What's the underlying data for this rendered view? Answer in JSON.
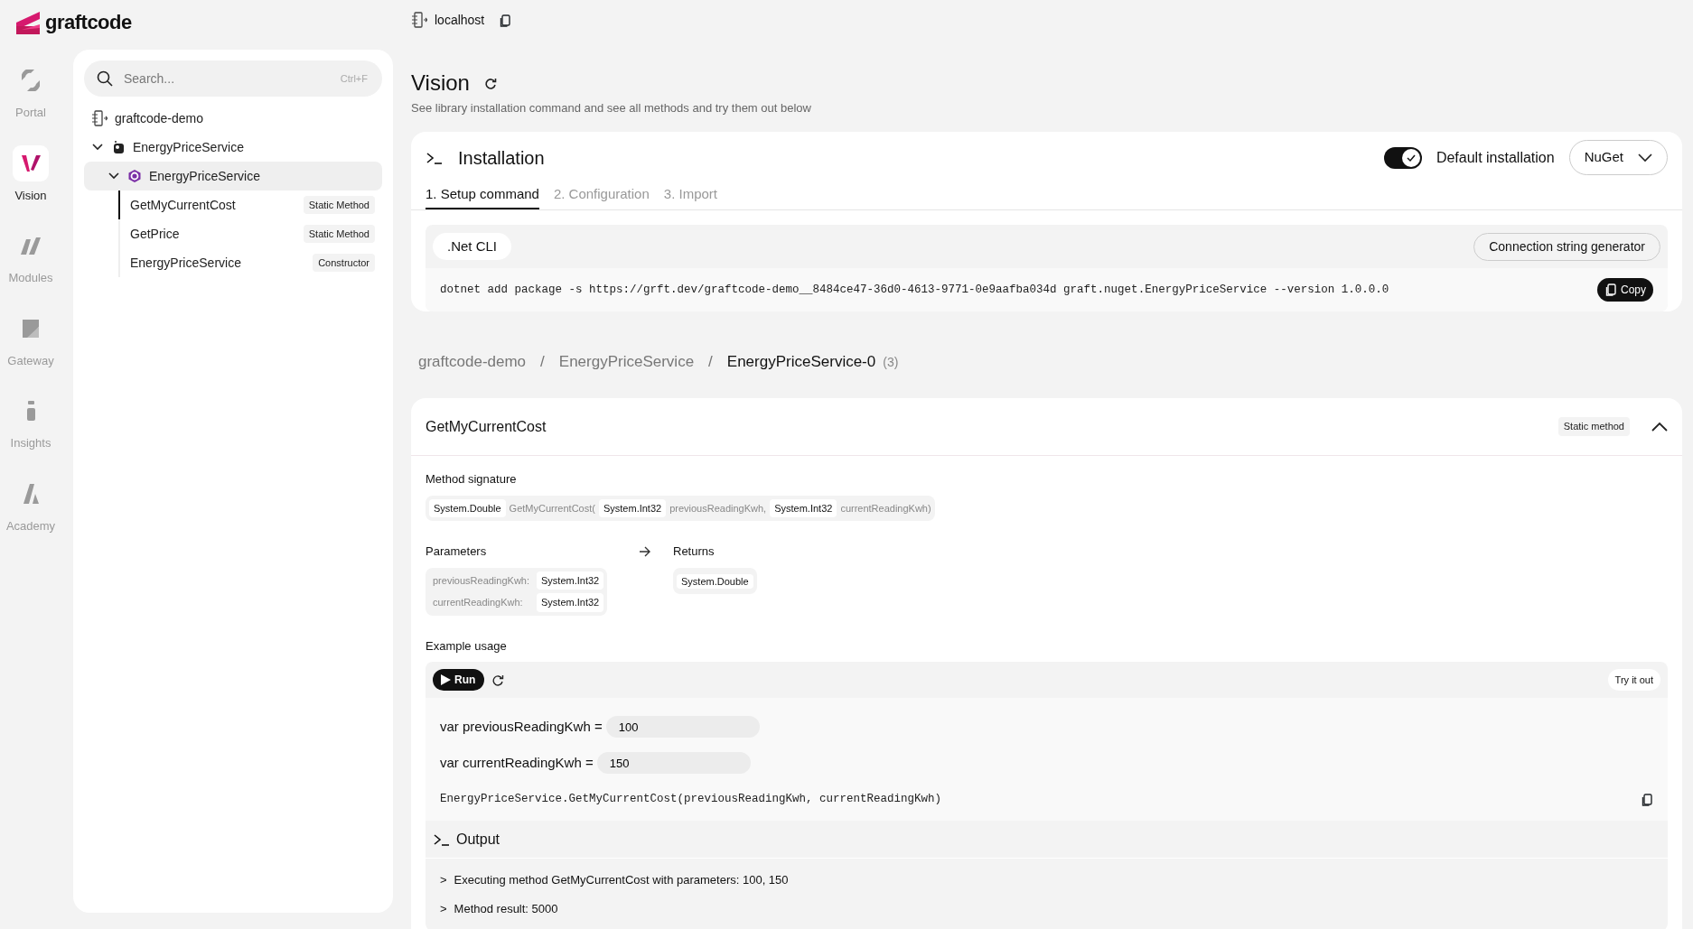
{
  "brand": {
    "name": "graftcode"
  },
  "rail": [
    {
      "label": "Portal",
      "kind": "portal",
      "selected": false
    },
    {
      "label": "Vision",
      "kind": "vision",
      "selected": true
    },
    {
      "label": "Modules",
      "kind": "modules",
      "selected": false
    },
    {
      "label": "Gateway",
      "kind": "gateway",
      "selected": false
    },
    {
      "label": "Insights",
      "kind": "insights",
      "selected": false
    },
    {
      "label": "Academy",
      "kind": "academy",
      "selected": false
    }
  ],
  "search": {
    "placeholder": "Search...",
    "shortcut": "Ctrl+F"
  },
  "tree": [
    {
      "label": "graftcode-demo",
      "kind": "host",
      "children": [
        {
          "label": "EnergyPriceService",
          "kind": "package",
          "expanded": true,
          "selected": false,
          "children": [
            {
              "label": "EnergyPriceService",
              "kind": "class",
              "expanded": true,
              "selected": true,
              "children": [
                {
                  "label": "GetMyCurrentCost",
                  "kind": "method",
                  "badge": "Static Method",
                  "selected": true
                },
                {
                  "label": "GetPrice",
                  "kind": "method",
                  "badge": "Static Method",
                  "selected": false
                },
                {
                  "label": "EnergyPriceService",
                  "kind": "method",
                  "badge": "Constructor",
                  "selected": false
                }
              ]
            }
          ]
        }
      ]
    }
  ],
  "host": {
    "label": "localhost"
  },
  "page": {
    "title": "Vision",
    "subtitle": "See library installation command and see all methods and try them out below"
  },
  "installation": {
    "title": "Installation",
    "default_installation": {
      "label": "Default installation",
      "on": true
    },
    "package_manager": "NuGet",
    "steps": [
      {
        "label": "1. Setup command",
        "selected": true
      },
      {
        "label": "2. Configuration",
        "selected": false
      },
      {
        "label": "3. Import",
        "selected": false
      }
    ],
    "tool_tab": ".Net CLI",
    "generator_button": "Connection string generator",
    "command": "dotnet add package -s https://grft.dev/graftcode-demo__8484ce47-36d0-4613-9771-0e9aafba034d graft.nuget.EnergyPriceService --version 1.0.0.0",
    "copy_button": "Copy"
  },
  "breadcrumb": {
    "items": [
      {
        "label": "graftcode-demo"
      },
      {
        "label": "EnergyPriceService"
      },
      {
        "label": "EnergyPriceService-0"
      }
    ],
    "separator": "/",
    "count": "(3)"
  },
  "method": {
    "name": "GetMyCurrentCost",
    "badge": "Static method",
    "expanded": true,
    "signature_label": "Method signature",
    "signature": [
      {
        "kind": "type",
        "text": "System.Double"
      },
      {
        "kind": "text",
        "text": "GetMyCurrentCost("
      },
      {
        "kind": "type",
        "text": "System.Int32"
      },
      {
        "kind": "text",
        "text": "previousReadingKwh,"
      },
      {
        "kind": "type",
        "text": "System.Int32"
      },
      {
        "kind": "text",
        "text": "currentReadingKwh)"
      }
    ],
    "parameters_label": "Parameters",
    "parameters": [
      {
        "name": "previousReadingKwh:",
        "type": "System.Int32"
      },
      {
        "name": "currentReadingKwh:",
        "type": "System.Int32"
      }
    ],
    "returns_label": "Returns",
    "returns": "System.Double",
    "example": {
      "label": "Example usage",
      "run_button": "Run",
      "try_button": "Try it out",
      "variables": [
        {
          "label": "var previousReadingKwh =",
          "value": "100"
        },
        {
          "label": "var currentReadingKwh =",
          "value": "150"
        }
      ],
      "call": "EnergyPriceService.GetMyCurrentCost(previousReadingKwh, currentReadingKwh)",
      "output": {
        "title": "Output",
        "lines": [
          {
            "prompt": ">",
            "text": "Executing method GetMyCurrentCost with parameters: 100, 150"
          },
          {
            "prompt": ">",
            "text": "Method result: 5000"
          }
        ]
      }
    }
  }
}
